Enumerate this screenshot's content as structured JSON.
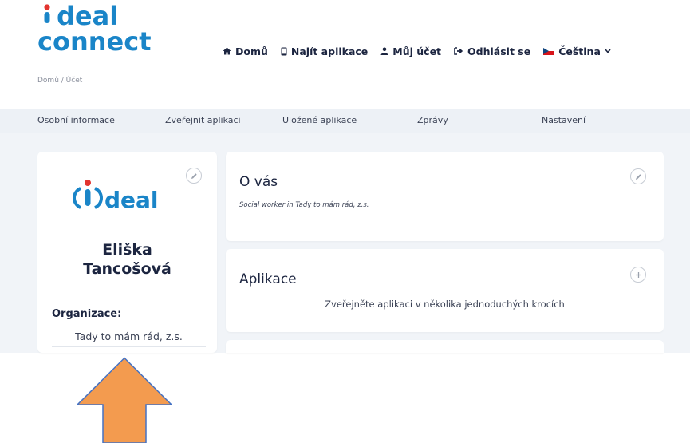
{
  "header": {
    "logo": {
      "line1": "deal",
      "line2": "connect"
    },
    "nav": [
      {
        "label": "Domů",
        "icon": "home-icon"
      },
      {
        "label": "Najít aplikace",
        "icon": "mobile-icon"
      },
      {
        "label": "Můj účet",
        "icon": "user-icon"
      },
      {
        "label": "Odhlásit se",
        "icon": "sign-out-icon"
      },
      {
        "label": "Čeština",
        "icon": "czech-flag-icon"
      }
    ]
  },
  "breadcrumb": "Domů / Účet",
  "tabs": [
    {
      "label": "Osobní informace"
    },
    {
      "label": "Zveřejnit aplikaci"
    },
    {
      "label": "Uložené aplikace"
    },
    {
      "label": "Zprávy"
    },
    {
      "label": "Nastavení"
    }
  ],
  "profile": {
    "logo_text": "deal",
    "first_name": "Eliška",
    "last_name": "Tancošová",
    "org_label": "Organizace:",
    "org_value": "Tady to mám rád, z.s."
  },
  "about": {
    "title": "O vás",
    "text": "Social worker in Tady to mám rád, z.s."
  },
  "apps": {
    "title": "Aplikace",
    "text": "Zveřejněte aplikaci v několika jednoduchých krocích"
  },
  "colors": {
    "brand_blue": "#1a85c8",
    "accent_red": "#e3342f",
    "arrow_orange": "#f39b4f",
    "arrow_stroke": "#4472c4",
    "tab_bar": "#edf1f6",
    "content_bg": "#f1f4f8"
  }
}
